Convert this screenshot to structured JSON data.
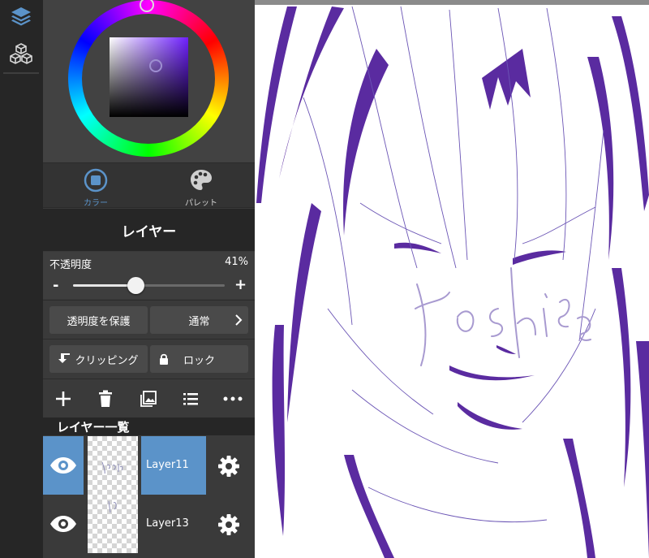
{
  "colors": {
    "accent": "#5b93c9",
    "current_color": "#6f20ff",
    "line_art": "#5a2ba0"
  },
  "rail": {
    "items": [
      {
        "icon": "layers-icon"
      },
      {
        "icon": "materials-icon"
      }
    ]
  },
  "color_tabs": {
    "color_label": "カラー",
    "palette_label": "パレット"
  },
  "layer_panel": {
    "title": "レイヤー",
    "opacity_label": "不透明度",
    "opacity_value": "41%",
    "opacity_fraction": 0.41,
    "protect_alpha_label": "透明度を保護",
    "blend_mode_label": "通常",
    "clipping_label": "クリッピング",
    "lock_label": "ロック",
    "list_title": "レイヤー一覧"
  },
  "layers": [
    {
      "name": "Layer11",
      "selected": true
    },
    {
      "name": "Layer13",
      "selected": false
    }
  ]
}
